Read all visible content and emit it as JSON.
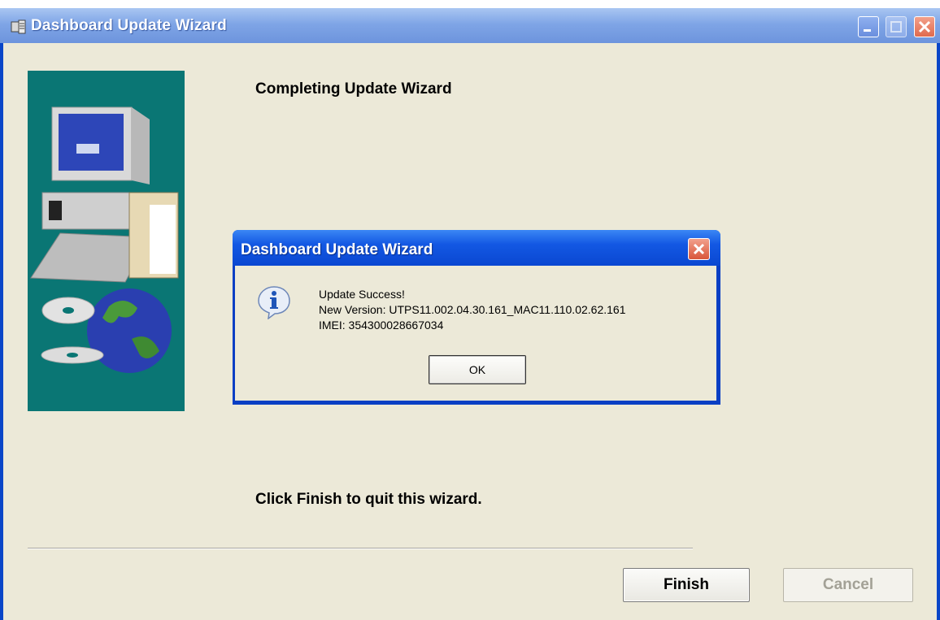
{
  "window": {
    "title": "Dashboard Update Wizard",
    "heading": "Completing Update Wizard",
    "finish_hint": "Click Finish to quit this wizard.",
    "buttons": {
      "finish": "Finish",
      "cancel": "Cancel"
    }
  },
  "dialog": {
    "title": "Dashboard Update Wizard",
    "lines": [
      "Update Success!",
      "New Version: UTPS11.002.04.30.161_MAC11.110.02.62.161",
      "IMEI: 354300028667034"
    ],
    "ok_label": "OK",
    "icon": "info-icon"
  },
  "colors": {
    "titlebar": "#7fa5e6",
    "dialog_titlebar": "#1358e3",
    "panel": "#0a7674",
    "face": "#ece9d8"
  }
}
